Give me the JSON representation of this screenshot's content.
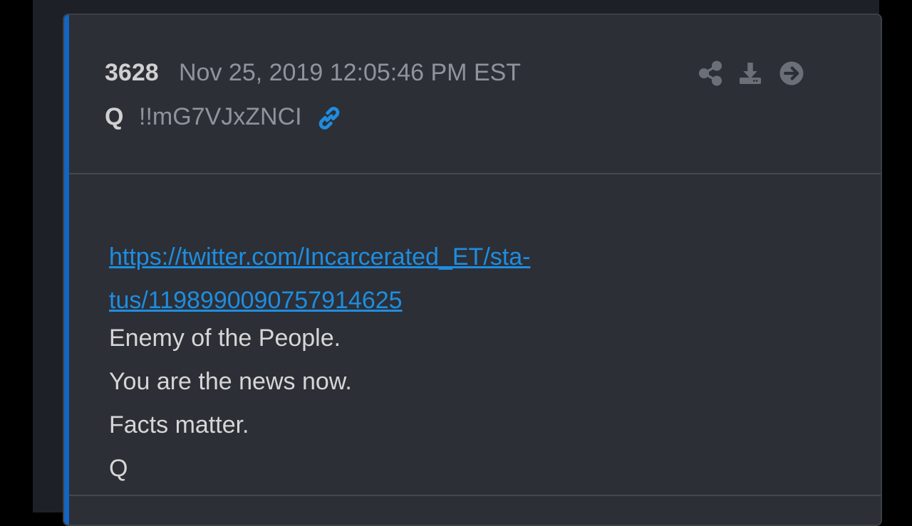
{
  "post": {
    "number": "3628",
    "timestamp": "Nov 25, 2019 12:05:46 PM EST",
    "author": "Q",
    "tripcode": "!!mG7VJxZNCI",
    "link_line1": "https://twitter.com/Incarcerated_ET/sta-",
    "link_line2": "tus/1198990090757914625",
    "lines": [
      "Enemy of the People.",
      "You are the news now.",
      "Facts matter.",
      "Q"
    ]
  },
  "icons": {
    "link": "link-icon",
    "share": "share-icon",
    "download": "download-icon",
    "next": "arrow-right-circle-icon"
  },
  "colors": {
    "accent": "#1565c0",
    "link": "#1e8de0",
    "card_bg": "#2c2f36",
    "page_bg": "#1d2026"
  }
}
